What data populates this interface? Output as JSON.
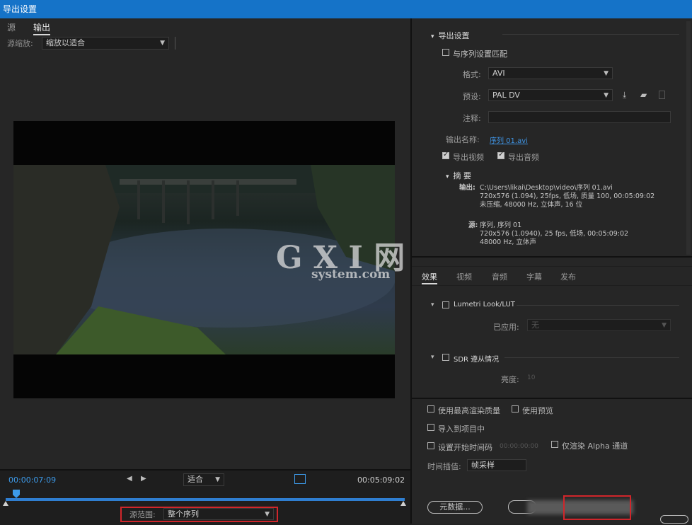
{
  "window": {
    "title": "导出设置"
  },
  "left": {
    "tabs": [
      {
        "label": "源"
      },
      {
        "label": "输出"
      }
    ],
    "source_scale": {
      "label": "源缩放:",
      "value": "缩放以适合"
    },
    "timeline": {
      "current_time": "00:00:07:09",
      "fit": "适合",
      "duration": "00:05:09:02"
    },
    "range": {
      "label": "源范围:",
      "value": "整个序列"
    },
    "watermark": {
      "brand": "G X I 网",
      "site": "system.com"
    }
  },
  "export": {
    "section_title": "导出设置",
    "match_sequence": "与序列设置匹配",
    "format": {
      "label": "格式:",
      "value": "AVI"
    },
    "preset": {
      "label": "预设:",
      "value": "PAL DV"
    },
    "comment": {
      "label": "注释:",
      "value": ""
    },
    "output_name": {
      "label": "输出名称:",
      "value": "序列 01.avi"
    },
    "export_video": "导出视频",
    "export_audio": "导出音频"
  },
  "summary": {
    "title": "摘 要",
    "output_label": "输出:",
    "output_lines": [
      "C:\\Users\\likai\\Desktop\\video\\序列 01.avi",
      "720x576 (1.094), 25fps, 低场, 质量 100, 00:05:09:02",
      "未压缩, 48000 Hz, 立体声, 16 位"
    ],
    "source_label": "源:",
    "source_lines": [
      "序列, 序列 01",
      "720x576 (1.0940), 25 fps, 低场, 00:05:09:02",
      "48000 Hz, 立体声"
    ]
  },
  "bottom_tabs": [
    {
      "label": "效果"
    },
    {
      "label": "视频"
    },
    {
      "label": "音频"
    },
    {
      "label": "字幕"
    },
    {
      "label": "发布"
    }
  ],
  "effects": {
    "lumetri": {
      "title": "Lumetri Look/LUT",
      "applied_label": "已应用:",
      "applied_value": "无"
    },
    "sdr": {
      "title": "SDR 遵从情况",
      "brightness_label": "亮度:",
      "brightness_value": "10"
    }
  },
  "options": {
    "max_quality": "使用最高渲染质量",
    "use_preview": "使用预览",
    "import_project": "导入到项目中",
    "set_timecode": "设置开始时间码",
    "timecode_value": "00:00:00:00",
    "alpha_only": "仅渲染 Alpha 通道",
    "interp_label": "时间插值:",
    "interp_value": "帧采样"
  },
  "buttons": {
    "metadata": "元数据..."
  },
  "colors": {
    "titlebar": "#1573c8",
    "accent": "#3d9bea",
    "highlight": "#d0262b"
  }
}
